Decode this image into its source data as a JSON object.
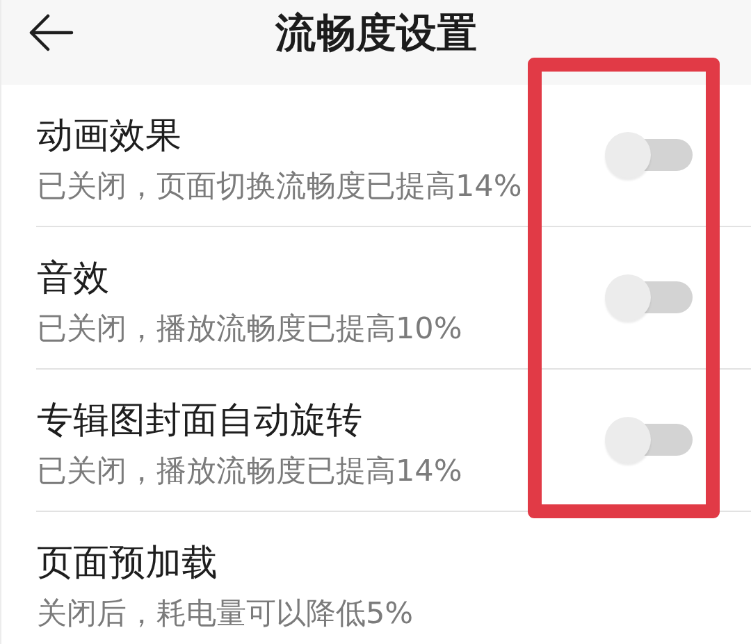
{
  "header": {
    "title": "流畅度设置"
  },
  "settings": [
    {
      "title": "动画效果",
      "subtitle": "已关闭，页面切换流畅度已提高14%",
      "on": false
    },
    {
      "title": "音效",
      "subtitle": "已关闭，播放流畅度已提高10%",
      "on": false
    },
    {
      "title": "专辑图封面自动旋转",
      "subtitle": "已关闭，播放流畅度已提高14%",
      "on": false
    },
    {
      "title": "页面预加载",
      "subtitle": "关闭后，耗电量可以降低5%"
    }
  ],
  "annotations": [
    {
      "kind": "frame"
    }
  ]
}
